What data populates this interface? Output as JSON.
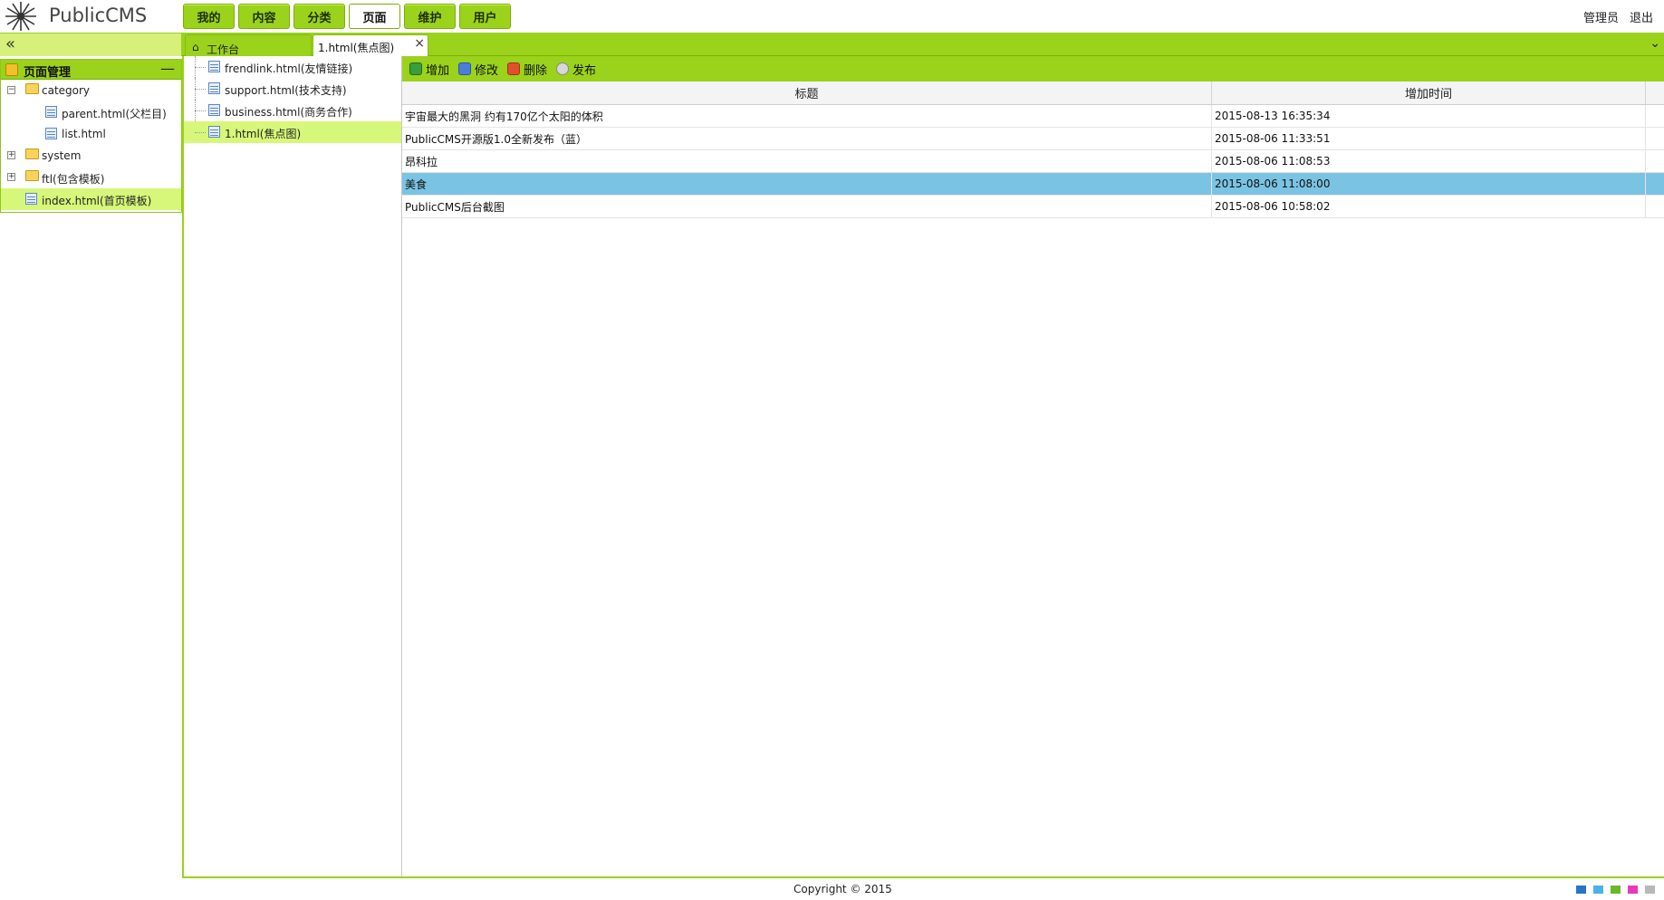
{
  "app": {
    "title": "PublicCMS"
  },
  "nav": {
    "items": [
      {
        "label": "我的"
      },
      {
        "label": "内容"
      },
      {
        "label": "分类"
      },
      {
        "label": "页面"
      },
      {
        "label": "维护"
      },
      {
        "label": "用户"
      }
    ],
    "active": "页面"
  },
  "user": {
    "name": "管理员",
    "logout": "退出"
  },
  "left_panel": {
    "title": "页面管理",
    "tree": [
      {
        "label": "category",
        "type": "folder",
        "expanded": true
      },
      {
        "label": "parent.html(父栏目)",
        "type": "file"
      },
      {
        "label": "list.html",
        "type": "file"
      },
      {
        "label": "system",
        "type": "folder",
        "expanded": false
      },
      {
        "label": "ftl(包含模板)",
        "type": "folder",
        "expanded": false
      },
      {
        "label": "index.html(首页模板)",
        "type": "file",
        "selected": true
      }
    ]
  },
  "tabs": [
    {
      "label": "工作台",
      "icon": "home-icon"
    },
    {
      "label": "1.html(焦点图)",
      "active": true,
      "close": "×"
    }
  ],
  "file_list": [
    {
      "label": "frendlink.html(友情链接)"
    },
    {
      "label": "support.html(技术支持)"
    },
    {
      "label": "business.html(商务合作)"
    },
    {
      "label": "1.html(焦点图)",
      "selected": true
    }
  ],
  "toolbar": {
    "add": "增加",
    "edit": "修改",
    "delete": "删除",
    "publish": "发布"
  },
  "grid": {
    "columns": [
      "标题",
      "增加时间"
    ],
    "rows": [
      {
        "title": "宇宙最大的黑洞 约有170亿个太阳的体积",
        "time": "2015-08-13 16:35:34"
      },
      {
        "title": "PublicCMS开源版1.0全新发布（蓝）",
        "time": "2015-08-06 11:33:51"
      },
      {
        "title": "昂科拉",
        "time": "2015-08-06 11:08:53"
      },
      {
        "title": "美食",
        "time": "2015-08-06 11:08:00",
        "selected": true
      },
      {
        "title": "PublicCMS后台截图",
        "time": "2015-08-06 10:58:02"
      }
    ]
  },
  "footer": {
    "copyright": "Copyright © 2015"
  },
  "colors": {
    "accent": "#9ad21c",
    "accent_light": "#d6f779",
    "row_selected": "#7bc3e3",
    "theme_swatches": [
      "#2a73c8",
      "#4bb2e8",
      "#6ab82a",
      "#e83ab8",
      "#b8b8b8"
    ]
  }
}
